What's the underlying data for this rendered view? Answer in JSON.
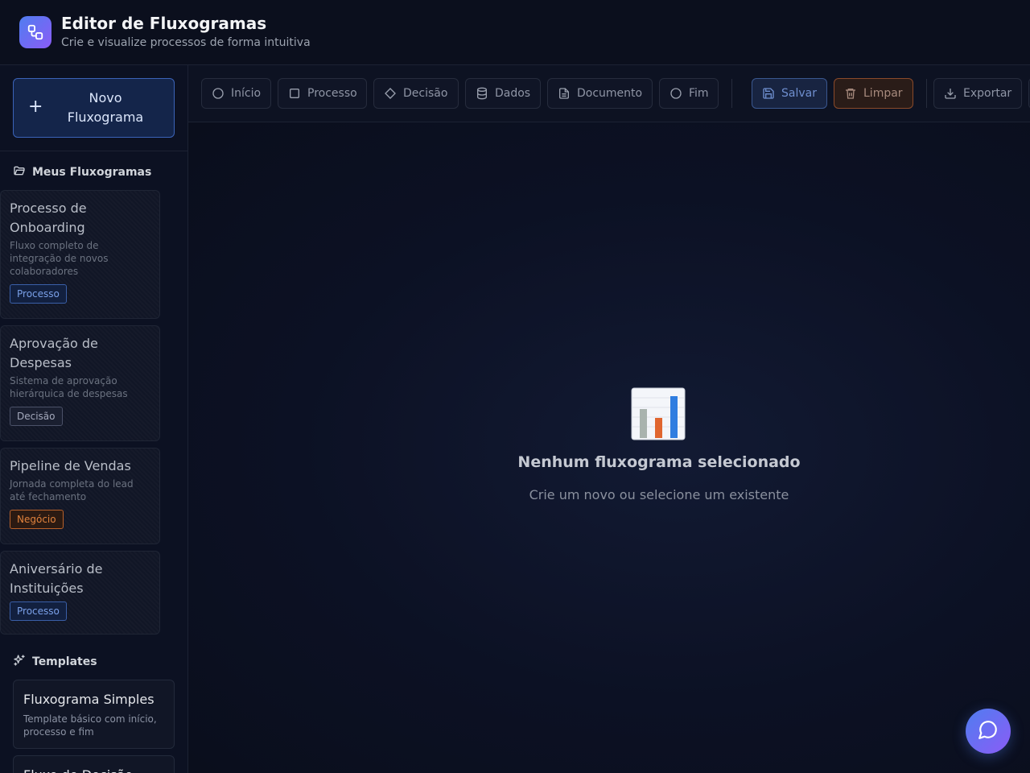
{
  "header": {
    "title": "Editor de Fluxogramas",
    "subtitle": "Crie e visualize processos de forma intuitiva",
    "logo_icon": "flowchart-nodes-icon"
  },
  "sidebar": {
    "new_button_label": "Novo Fluxograma",
    "my_flows": {
      "heading": "Meus Fluxogramas",
      "items": [
        {
          "title": "Processo de Onboarding",
          "description": "Fluxo completo de integração de novos colaboradores",
          "tag": "Processo",
          "tag_color": "#3a5fa8"
        },
        {
          "title": "Aprovação de Despesas",
          "description": "Sistema de aprovação hierárquica de despesas",
          "tag": "Decisão",
          "tag_color": "#4b5168"
        },
        {
          "title": "Pipeline de Vendas",
          "description": "Jornada completa do lead até fechamento",
          "tag": "Negócio",
          "tag_color": "#b8612a"
        },
        {
          "title": "Aniversário de Instituições",
          "description": "",
          "tag": "Processo",
          "tag_color": "#3a5fa8"
        }
      ]
    },
    "templates": {
      "heading": "Templates",
      "items": [
        {
          "title": "Fluxograma Simples",
          "description": "Template básico com início, processo e fim"
        },
        {
          "title": "Fluxo de Decisão",
          "description": ""
        }
      ]
    }
  },
  "toolbar": {
    "shapes": [
      {
        "label": "Início",
        "icon": "circle-icon"
      },
      {
        "label": "Processo",
        "icon": "square-icon"
      },
      {
        "label": "Decisão",
        "icon": "diamond-icon"
      },
      {
        "label": "Dados",
        "icon": "database-icon"
      },
      {
        "label": "Documento",
        "icon": "document-icon"
      },
      {
        "label": "Fim",
        "icon": "circle-icon"
      }
    ],
    "save_label": "Salvar",
    "clear_label": "Limpar",
    "export_label": "Exportar"
  },
  "canvas": {
    "empty_icon": "bar-chart-icon",
    "empty_title": "Nenhum fluxograma selecionado",
    "empty_subtitle": "Crie um novo ou selecione um existente"
  },
  "colors": {
    "accent": "#4f7df0",
    "accent_secondary": "#8b5cf6",
    "background": "#0c1020"
  }
}
